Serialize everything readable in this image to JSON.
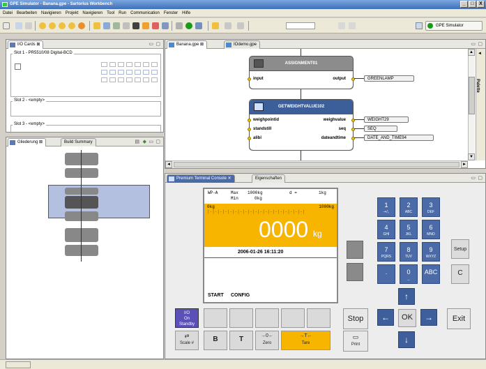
{
  "window": {
    "title": "GPE Simulator - Banana.gpe - Sartorius Workbench",
    "controls": [
      "_",
      "□",
      "X"
    ]
  },
  "menu": [
    "Datei",
    "Bearbeiten",
    "Navigieren",
    "Projekt",
    "Navigieren",
    "Tool",
    "Run",
    "Communication",
    "Fenster",
    "Hilfe"
  ],
  "perspective": {
    "label": "GPE Simulator"
  },
  "io_cards": {
    "tab": "I/O Cards",
    "slot1": "Slot 1 - PR5510/08 Digital-BCD",
    "slot2": "Slot 2 - <empty>",
    "slot3": "Slot 3 - <empty>"
  },
  "outline": {
    "tab1": "Gliederung",
    "tab2": "Build Summary"
  },
  "editor": {
    "tab1": "Banana.gpe",
    "tab2": "IOdemo.gpe",
    "palette": "Palette",
    "assignment": {
      "title": "ASSIGNMENT01",
      "input": "input",
      "output": "output",
      "output_value": "GREENLAMP"
    },
    "getweight": {
      "title": "GETWEIGHTVALUE102",
      "in1": "weighpointid",
      "in2": "standstill",
      "in3": "alibi",
      "out1": "weighvalue",
      "out2": "seq",
      "out3": "dateandtime",
      "v1": "WEIGHT29",
      "v2": "SEQ",
      "v3": "DATE_AND_TIME94"
    }
  },
  "console": {
    "tab1": "Premium Terminal Console",
    "tab2": "Eigenschaften",
    "screen": {
      "wp": "WP-A",
      "max": "Max",
      "max_val": "1000kg",
      "min": "Min",
      "min_val": "0kg",
      "d": "d =",
      "d_val": "1kg",
      "scale_left": "0kg",
      "scale_right": "1000kg",
      "bargraph": "|-|-|-|-|-|-|-|-|-|-|-|-|-|-|-|-|-|-|-|",
      "weight": "0000",
      "unit": "kg",
      "datetime": "2006-01-26  16:11:20",
      "soft1": "START",
      "soft2": "CONFIG"
    },
    "left_key": {
      "line1": "I/O",
      "line2": "On",
      "line3": "Standby"
    },
    "fkeys": [
      {
        "icon": "⇄",
        "label": "Scale #"
      },
      {
        "icon": "B",
        "label": ""
      },
      {
        "icon": "T",
        "label": ""
      },
      {
        "icon": "→0←",
        "label": "Zero"
      },
      {
        "icon": "→T←",
        "label": "Tare"
      }
    ],
    "stop": "Stop",
    "print": "Print",
    "numpad": [
      {
        "main": "1",
        "sub": "-+/;."
      },
      {
        "main": "2",
        "sub": "ABC"
      },
      {
        "main": "3",
        "sub": "DEF"
      },
      {
        "main": "4",
        "sub": "GHI"
      },
      {
        "main": "5",
        "sub": "JKL"
      },
      {
        "main": "6",
        "sub": "MNO"
      },
      {
        "main": "7",
        "sub": "PQRS"
      },
      {
        "main": "8",
        "sub": "TUV"
      },
      {
        "main": "9",
        "sub": "WXYZ"
      },
      {
        "main": ".",
        "sub": ""
      },
      {
        "main": "0",
        "sub": "_"
      },
      {
        "main": "ABC",
        "sub": ""
      }
    ],
    "setup": "Setup",
    "clear": "C",
    "nav": {
      "up": "↑",
      "left": "←",
      "ok": "OK",
      "right": "→",
      "down": "↓"
    },
    "exit": "Exit"
  },
  "colors": {
    "display": "#f7b500",
    "key": "#4a6ba8",
    "node_head": "#8c8c8c",
    "node_head2": "#3c5f9a"
  }
}
